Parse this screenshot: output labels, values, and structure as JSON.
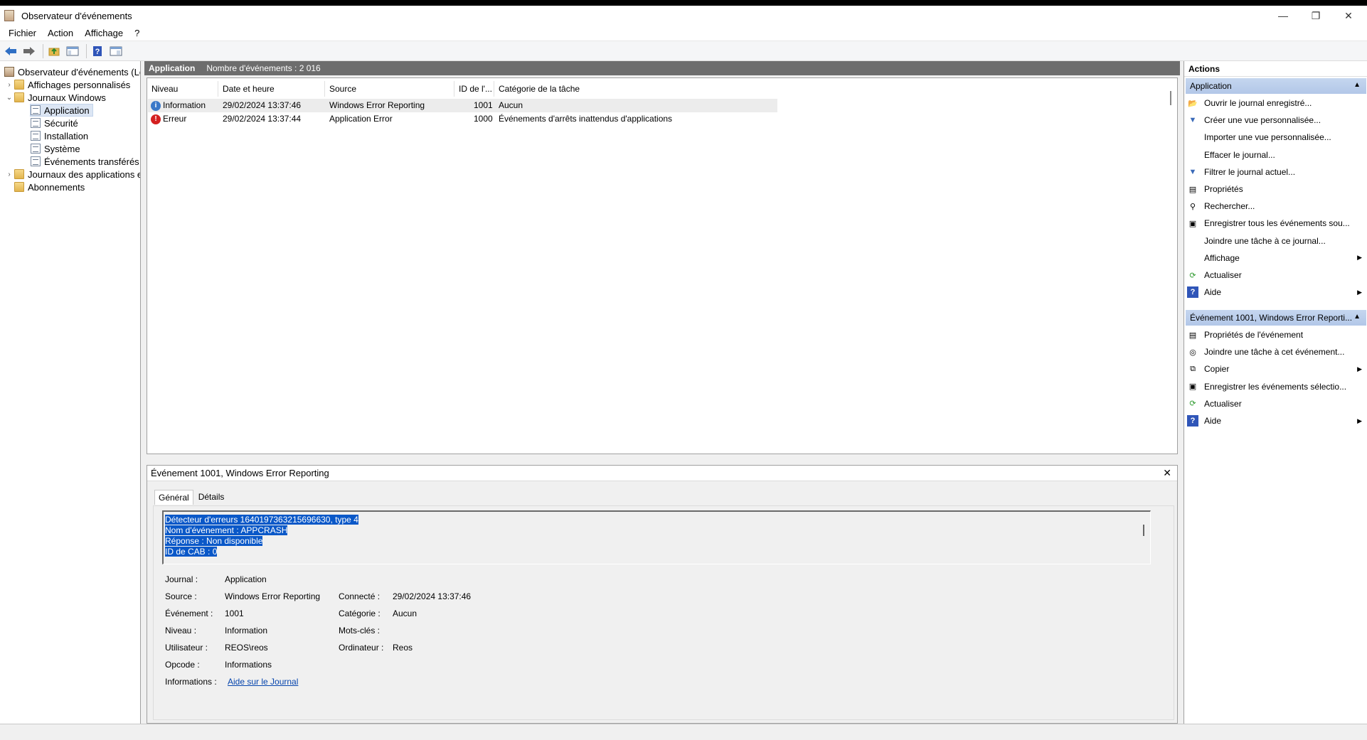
{
  "window": {
    "title": "Observateur d'événements",
    "controls": {
      "minimize": "—",
      "restore": "❐",
      "close": "✕"
    }
  },
  "menu": [
    "Fichier",
    "Action",
    "Affichage",
    "?"
  ],
  "toolbar": [
    "back-icon",
    "forward-icon",
    "up-folder-icon",
    "console-tree-icon",
    "help-icon",
    "action-pane-icon"
  ],
  "tree": {
    "root": "Observateur d'événements (Loca",
    "custom_views": "Affichages personnalisés",
    "windows_logs": "Journaux Windows",
    "application": "Application",
    "security": "Sécurité",
    "setup": "Installation",
    "system": "Système",
    "forwarded": "Événements transférés",
    "apps_services": "Journaux des applications et",
    "subscriptions": "Abonnements"
  },
  "center": {
    "log_name": "Application",
    "count_label": "Nombre d'événements : 2 016",
    "columns": [
      "Niveau",
      "Date et heure",
      "Source",
      "ID de l'...",
      "Catégorie de la tâche"
    ],
    "rows": [
      {
        "level": "Information",
        "level_type": "info",
        "datetime": "29/02/2024 13:37:46",
        "source": "Windows Error Reporting",
        "id": "1001",
        "category": "Aucun"
      },
      {
        "level": "Erreur",
        "level_type": "error",
        "datetime": "29/02/2024 13:37:44",
        "source": "Application Error",
        "id": "1000",
        "category": "Événements d'arrêts inattendus d'applications"
      }
    ]
  },
  "detail": {
    "title": "Événement 1001, Windows Error Reporting",
    "close": "✕",
    "tabs": [
      "Général",
      "Détails"
    ],
    "description": [
      "Détecteur d'erreurs 1640197363215696630, type 4",
      "Nom d'événement : APPCRASH",
      "Réponse : Non disponible",
      "ID de CAB : 0"
    ],
    "fields": {
      "journal_label": "Journal :",
      "journal_value": "Application",
      "source_label": "Source :",
      "source_value": "Windows Error Reporting",
      "event_label": "Événement :",
      "event_value": "1001",
      "level_label": "Niveau :",
      "level_value": "Information",
      "user_label": "Utilisateur :",
      "user_value": "REOS\\reos",
      "opcode_label": "Opcode :",
      "opcode_value": "Informations",
      "info_label": "Informations :",
      "info_link": "Aide sur le Journal",
      "logged_label": "Connecté :",
      "logged_value": "29/02/2024 13:37:46",
      "category_label": "Catégorie :",
      "category_value": "Aucun",
      "keywords_label": "Mots-clés :",
      "keywords_value": "",
      "computer_label": "Ordinateur :",
      "computer_value": "Reos"
    }
  },
  "actions": {
    "header": "Actions",
    "section1": "Application",
    "items1": [
      {
        "label": "Ouvrir le journal enregistré...",
        "icon": "open-folder-icon",
        "glyph": "📂",
        "sub": false
      },
      {
        "label": "Créer une vue personnalisée...",
        "icon": "filter-create-icon",
        "glyph": "▼",
        "sub": false
      },
      {
        "label": "Importer une vue personnalisée...",
        "icon": "",
        "glyph": "",
        "sub": false
      },
      {
        "label": "Effacer le journal...",
        "icon": "",
        "glyph": "",
        "sub": false
      },
      {
        "label": "Filtrer le journal actuel...",
        "icon": "filter-icon",
        "glyph": "▼",
        "sub": false
      },
      {
        "label": "Propriétés",
        "icon": "properties-icon",
        "glyph": "▤",
        "sub": false
      },
      {
        "label": "Rechercher...",
        "icon": "binoculars-icon",
        "glyph": "⚲",
        "sub": false
      },
      {
        "label": "Enregistrer tous les événements sou...",
        "icon": "save-icon",
        "glyph": "▣",
        "sub": false
      },
      {
        "label": "Joindre une tâche à ce journal...",
        "icon": "",
        "glyph": "",
        "sub": false
      },
      {
        "label": "Affichage",
        "icon": "",
        "glyph": "",
        "sub": true
      },
      {
        "label": "Actualiser",
        "icon": "refresh-icon",
        "glyph": "⟳",
        "sub": false
      },
      {
        "label": "Aide",
        "icon": "help-icon",
        "glyph": "?",
        "sub": true
      }
    ],
    "section2": "Événement 1001, Windows Error Reporti...",
    "items2": [
      {
        "label": "Propriétés de l'événement",
        "icon": "event-properties-icon",
        "glyph": "▤",
        "sub": false
      },
      {
        "label": "Joindre une tâche à cet événement...",
        "icon": "task-icon",
        "glyph": "◎",
        "sub": false
      },
      {
        "label": "Copier",
        "icon": "copy-icon",
        "glyph": "⧉",
        "sub": true
      },
      {
        "label": "Enregistrer les événements sélectio...",
        "icon": "save-icon",
        "glyph": "▣",
        "sub": false
      },
      {
        "label": "Actualiser",
        "icon": "refresh-icon",
        "glyph": "⟳",
        "sub": false
      },
      {
        "label": "Aide",
        "icon": "help-icon",
        "glyph": "?",
        "sub": true
      }
    ]
  },
  "colors": {
    "selection": "#0a58c8",
    "section_bg": "#b8cce9",
    "header_bg": "#6d6d6d",
    "info": "#3a78c8",
    "error": "#d42020"
  }
}
